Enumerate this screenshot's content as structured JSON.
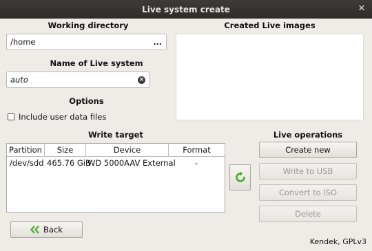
{
  "window": {
    "title": "Live system create",
    "close_glyph": "✕"
  },
  "working_directory": {
    "heading": "Working directory",
    "value": "/home",
    "browse_label": "..."
  },
  "live_name": {
    "heading": "Name of Live system",
    "value": "auto"
  },
  "options": {
    "heading": "Options",
    "include_user_data_label": "Include user data files",
    "include_user_data_checked": false
  },
  "created_images": {
    "heading": "Created Live images",
    "items": []
  },
  "write_target": {
    "heading": "Write target",
    "columns": [
      "Partition",
      "Size",
      "Device",
      "Format"
    ],
    "rows": [
      {
        "partition": "/dev/sdd",
        "size": "465.76 GiB",
        "device": "WD 5000AAV External",
        "format": "-"
      }
    ]
  },
  "live_operations": {
    "heading": "Live operations",
    "create_new": "Create new",
    "write_to_usb": "Write to USB",
    "convert_to_iso": "Convert to ISO",
    "delete": "Delete"
  },
  "back_button": {
    "label": "Back",
    "icon": "double-chevron-left-icon"
  },
  "refresh_icon": "refresh-icon",
  "colors": {
    "accent_green": "#3fae2a",
    "titlebar": "#3c3b37",
    "window_bg": "#efebe7"
  },
  "footer": "Kendek, GPLv3"
}
